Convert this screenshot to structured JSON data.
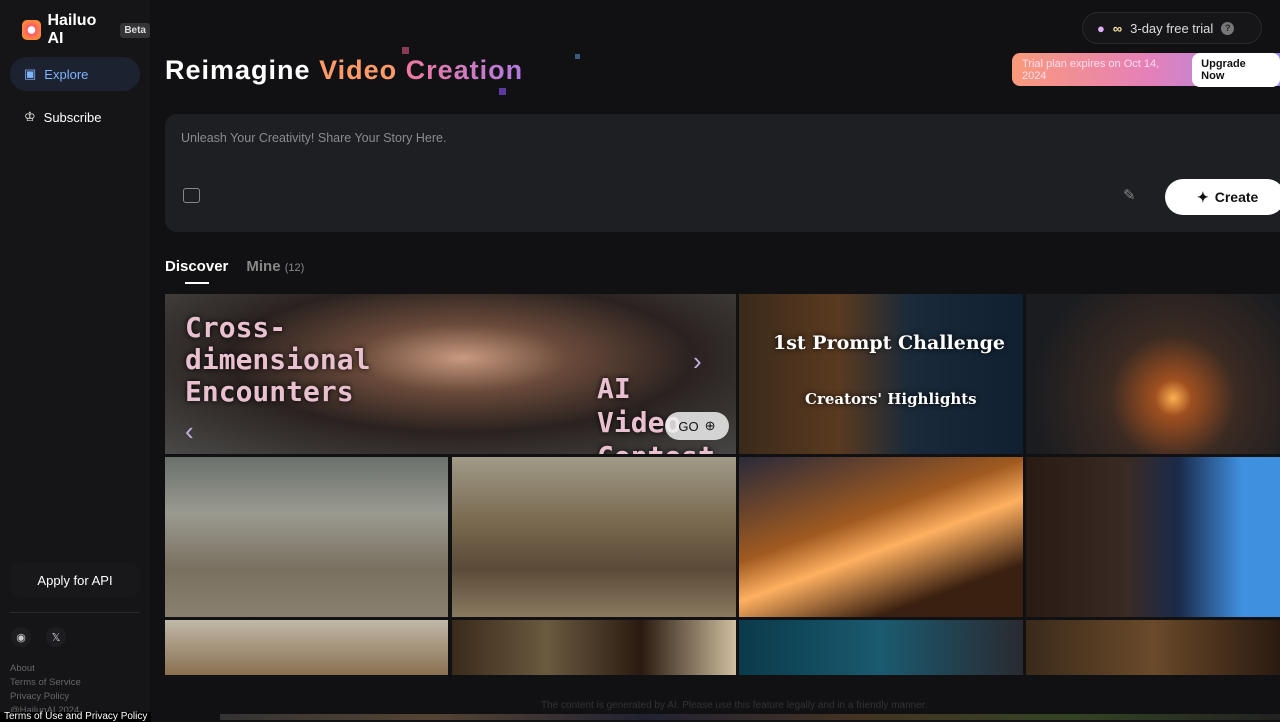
{
  "brand": {
    "name": "Hailuo AI",
    "badge": "Beta"
  },
  "sidebar": {
    "items": [
      {
        "label": "Explore",
        "icon": "compass-icon",
        "active": true
      },
      {
        "label": "Subscribe",
        "icon": "crown-icon"
      }
    ],
    "api_button": "Apply for API",
    "social": [
      {
        "icon": "discord-icon"
      },
      {
        "icon": "x-icon",
        "label": "𝕏"
      }
    ],
    "links": [
      "About",
      "Terms of Service",
      "Privacy Policy",
      "@HailuoAI 2024"
    ]
  },
  "header": {
    "title_a": "Reimagine",
    "title_b": "Video",
    "title_c": "Creation",
    "trial_label": "3-day free trial",
    "trial_symbol": "∞",
    "help": "?",
    "expire_text": "Trial plan expires on Oct 14, 2024",
    "upgrade": "Upgrade Now"
  },
  "prompt": {
    "placeholder": "Unleash Your Creativity! Share Your Story Here.",
    "create": "Create"
  },
  "tabs": [
    {
      "label": "Discover",
      "active": true
    },
    {
      "label": "Mine",
      "count": "(12)"
    }
  ],
  "gallery": {
    "banner": {
      "left_text": "Cross-dimensional Encounters",
      "right_text": "AI Video Contest",
      "go": "GO"
    },
    "challenge": {
      "title": "1st Prompt Challenge",
      "subtitle": "Creators' Highlights"
    }
  },
  "footer": {
    "notice": "The content is generated by AI. Please use this feature legally and in a friendly manner.",
    "overlay": "Terms of Use and Privacy Policy"
  }
}
